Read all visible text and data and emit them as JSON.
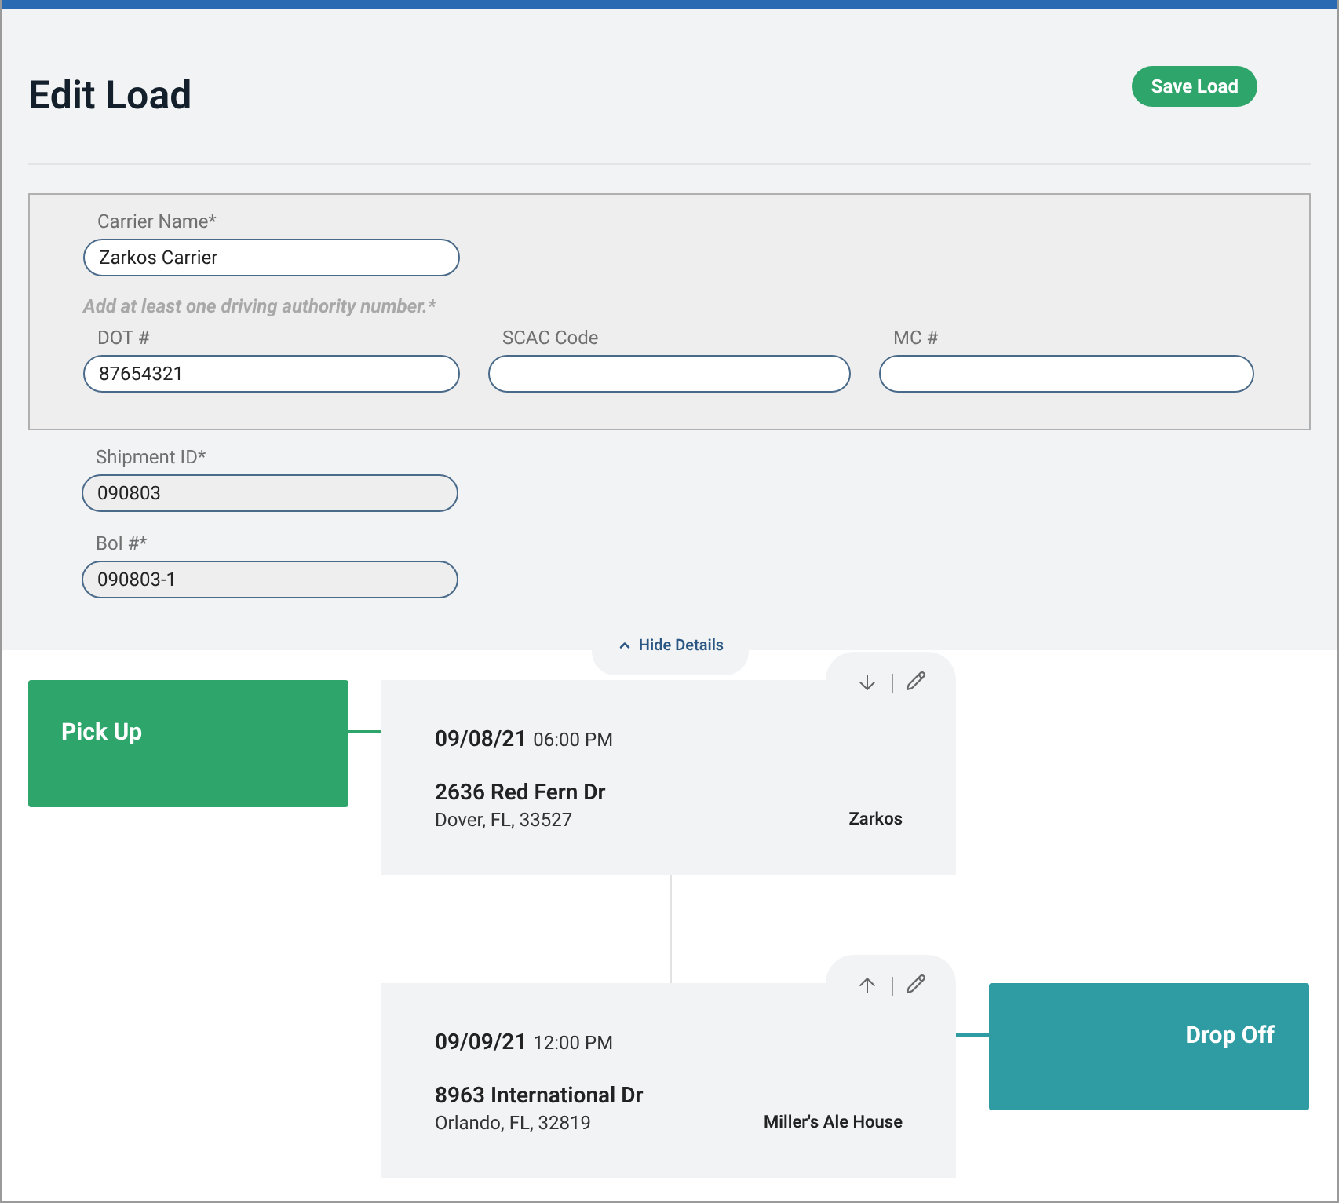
{
  "title": "Edit Load",
  "save_button": "Save Load",
  "carrier": {
    "fields": [
      {
        "label": "Carrier Name*",
        "value": "Zarkos Carrier",
        "disabled": false
      }
    ],
    "hint": "Add at least one driving authority number.*",
    "authority_fields": [
      {
        "label": "DOT #",
        "value": "87654321",
        "disabled": false
      },
      {
        "label": "SCAC Code",
        "disabled": false
      },
      {
        "label": "MC #",
        "disabled": false
      }
    ]
  },
  "fields": [
    {
      "label": "Shipment ID*",
      "value": "090803",
      "disabled": true
    },
    {
      "label": "Bol #*",
      "value": "090803-1",
      "disabled": true
    }
  ],
  "toggle": {
    "label": "Hide Details",
    "expanded": true
  },
  "stops": [
    {
      "kind": "pickup",
      "label": "Pick Up",
      "color": "#2ea56b",
      "date": "09/08/21",
      "time": "06:00 PM",
      "street": "2636 Red Fern Dr",
      "city": "Dover, FL, 33527",
      "name": "Zarkos"
    },
    {
      "kind": "dropoff",
      "label": "Drop Off",
      "color": "#2f9ca3",
      "date": "09/09/21",
      "time": "12:00 PM",
      "street": "8963 International Dr",
      "city": "Orlando, FL, 32819",
      "name": "Miller's Ale House"
    }
  ]
}
